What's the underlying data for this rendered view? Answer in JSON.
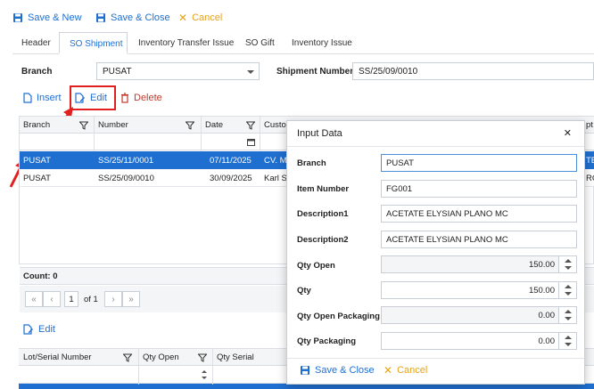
{
  "toolbar": {
    "save_new": "Save & New",
    "save_close": "Save & Close",
    "cancel": "Cancel"
  },
  "tabs": [
    {
      "label": "Header"
    },
    {
      "label": "SO Shipment"
    },
    {
      "label": "Inventory Transfer Issue"
    },
    {
      "label": "SO Gift"
    },
    {
      "label": "Inventory Issue"
    }
  ],
  "form": {
    "branch_label": "Branch",
    "branch_value": "PUSAT",
    "shipment_label": "Shipment Number",
    "shipment_value": "SS/25/09/0010"
  },
  "grid_toolbar": {
    "insert": "Insert",
    "edit": "Edit",
    "delete": "Delete"
  },
  "grid": {
    "columns": [
      "Branch",
      "Number",
      "Date",
      "Custo"
    ],
    "rows": [
      {
        "branch": "PUSAT",
        "number": "SS/25/11/0001",
        "date": "07/11/2025",
        "customer": "CV. M",
        "right": "TE"
      },
      {
        "branch": "PUSAT",
        "number": "SS/25/09/0010",
        "date": "30/09/2025",
        "customer": "Karl Sl",
        "right": "RC"
      }
    ],
    "right_header": "pt",
    "count": "Count: 0"
  },
  "pager": {
    "page": "1",
    "of": "of 1"
  },
  "lower": {
    "edit": "Edit",
    "columns": [
      "Lot/Serial Number",
      "Qty Open",
      "Qty Serial"
    ]
  },
  "dialog": {
    "title": "Input Data",
    "fields": {
      "branch": {
        "label": "Branch",
        "value": "PUSAT"
      },
      "item_number": {
        "label": "Item Number",
        "value": "FG001"
      },
      "description1": {
        "label": "Description1",
        "value": "ACETATE ELYSIAN PLANO MC"
      },
      "description2": {
        "label": "Description2",
        "value": "ACETATE ELYSIAN PLANO MC"
      },
      "qty_open": {
        "label": "Qty Open",
        "value": "150.00"
      },
      "qty": {
        "label": "Qty",
        "value": "150.00"
      },
      "qty_open_packaging": {
        "label": "Qty Open Packaging",
        "value": "0.00"
      },
      "qty_packaging": {
        "label": "Qty Packaging",
        "value": "0.00"
      }
    },
    "save_close": "Save & Close",
    "cancel": "Cancel"
  },
  "colors": {
    "accent": "#1f6fd0",
    "selected_row": "#1f6fd0",
    "delete": "#c0392b",
    "cancel": "#e8a317",
    "highlight_box": "#e02020"
  }
}
